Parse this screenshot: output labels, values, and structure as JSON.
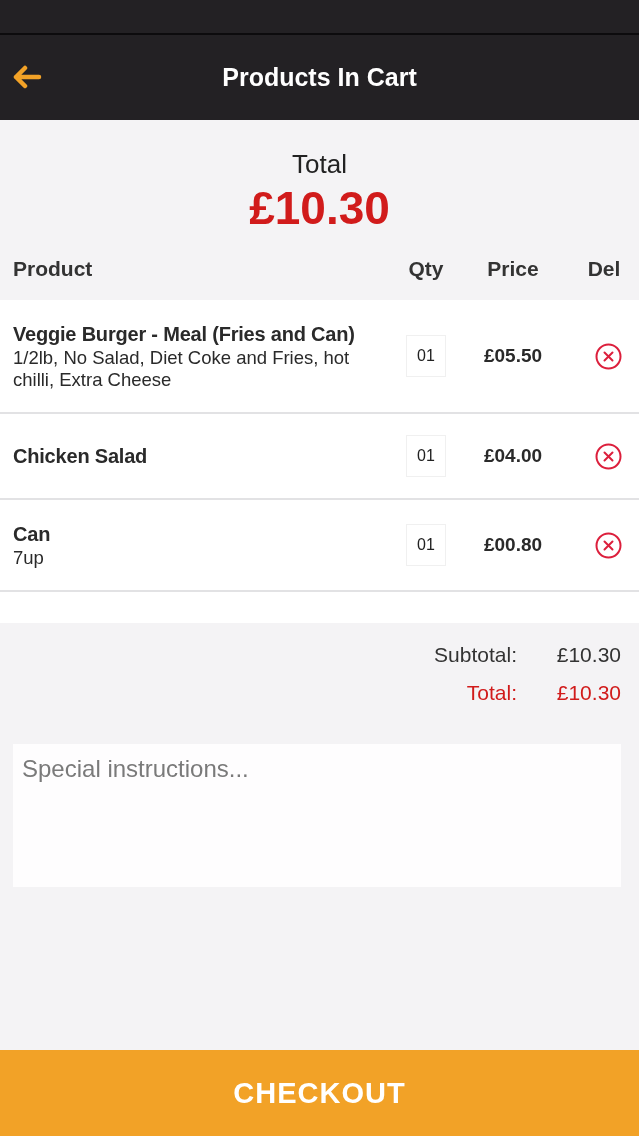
{
  "header": {
    "title": "Products In Cart"
  },
  "total": {
    "label": "Total",
    "amount": "£10.30"
  },
  "table": {
    "columns": [
      "Product",
      "Qty",
      "Price",
      "Del"
    ],
    "rows": [
      {
        "name": "Veggie Burger - Meal (Fries and Can)",
        "options": "1/2lb, No Salad, Diet Coke and Fries, hot chilli, Extra Cheese",
        "qty": "01",
        "price": "£05.50"
      },
      {
        "name": "Chicken Salad",
        "qty": "01",
        "price": "£04.00"
      },
      {
        "name": "Can",
        "options": "7up",
        "qty": "01",
        "price": "£00.80"
      }
    ]
  },
  "summary": [
    {
      "kind": "subtotal",
      "label": "Subtotal:",
      "value": "£10.30"
    },
    {
      "kind": "total",
      "label": "Total:",
      "value": "£10.30"
    }
  ],
  "instructions": {
    "placeholder": "Special instructions..."
  },
  "checkout_button": {
    "label": "CHECKOUT"
  }
}
